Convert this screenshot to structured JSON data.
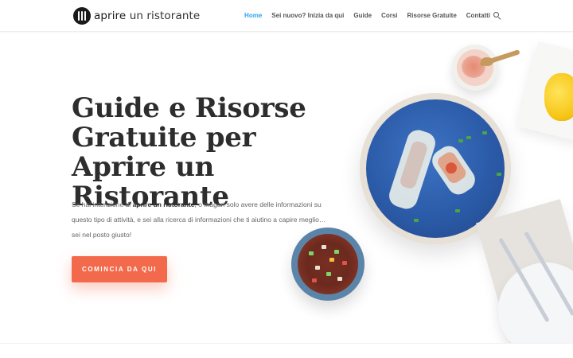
{
  "site": {
    "logo_text_a": "aprire",
    "logo_text_b": " un ristorante"
  },
  "nav": {
    "items": [
      {
        "label": "Home"
      },
      {
        "label": "Sei nuovo? Inizia da qui"
      },
      {
        "label": "Guide"
      },
      {
        "label": "Corsi"
      },
      {
        "label": "Risorse Gratuite"
      },
      {
        "label": "Contatti"
      }
    ],
    "active": "Home",
    "search_icon": "search-icon"
  },
  "hero": {
    "title": "Guide e Risorse Gratuite per Aprire un Ristorante",
    "text_before": "Se hai intenzione di ",
    "text_bold": "aprire un ristorante",
    "text_after": ", o magari solo avere delle informazioni su questo tipo di attività, e sei alla ricerca di informazioni che ti aiutino a capire meglio… sei nel posto giusto!",
    "cta_label": "COMINCIA DA QUI"
  },
  "colors": {
    "accent": "#2ea3f2",
    "cta": "#f26a4b",
    "title": "#2d2d2d"
  }
}
